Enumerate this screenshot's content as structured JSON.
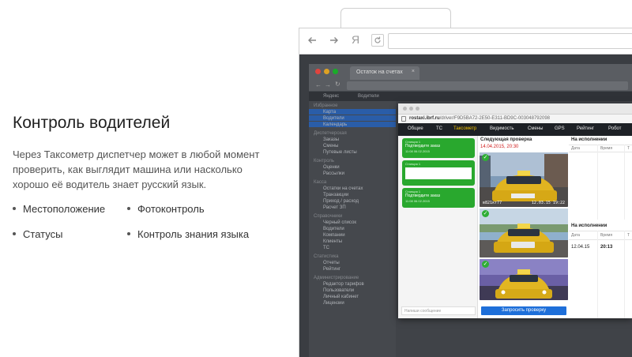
{
  "promo": {
    "title": "Контроль водителей",
    "description": "Через Таксометр диспетчер может в любой момент проверить, как выглядит машина или насколько хорошо её водитель знает русский язык.",
    "features": [
      "Местоположение",
      "Фотоконтроль",
      "Статусы",
      "Контроль знания языка"
    ]
  },
  "outer_browser": {
    "back_icon": "arrow-left",
    "forward_icon": "arrow-right",
    "yandex_logo": "Я",
    "reload_icon": "reload"
  },
  "inner_browser": {
    "tab_title": "Остаток на счетах",
    "topbar": [
      "Яндекс",
      "Водители"
    ],
    "sidebar": [
      {
        "label": "Избранное",
        "group": true
      },
      {
        "label": "Карта",
        "selected": true
      },
      {
        "label": "Водители",
        "selected": true
      },
      {
        "label": "Календарь",
        "selected": true
      },
      {
        "label": "Диспетчерская",
        "group": true
      },
      {
        "label": "Заказы"
      },
      {
        "label": "Смены"
      },
      {
        "label": "Путевые листы"
      },
      {
        "label": "Контроль",
        "group": true
      },
      {
        "label": "Оценки"
      },
      {
        "label": "Рассылки"
      },
      {
        "label": "Касса",
        "group": true
      },
      {
        "label": "Остатки на счетах"
      },
      {
        "label": "Транзакции"
      },
      {
        "label": "Приход / расход"
      },
      {
        "label": "Расчет ЗП"
      },
      {
        "label": "Справочники",
        "group": true
      },
      {
        "label": "Черный список"
      },
      {
        "label": "Водители"
      },
      {
        "label": "Компании"
      },
      {
        "label": "Клиенты"
      },
      {
        "label": "ТС"
      },
      {
        "label": "Статистика",
        "group": true
      },
      {
        "label": "Отчеты"
      },
      {
        "label": "Рейтинг"
      },
      {
        "label": "Администрирование",
        "group": true
      },
      {
        "label": "Редактор тарифов"
      },
      {
        "label": "Пользователи"
      },
      {
        "label": "Личный кабинет"
      },
      {
        "label": "Лицензии"
      }
    ]
  },
  "popup": {
    "url_host": "rostaxi.ibrf.ru",
    "url_path": "/driver/F9D5BA72-2E50-E311-BD9C-003048792098",
    "tabs": [
      "Общие",
      "ТС",
      "Таксометр",
      "Видимость",
      "Смены",
      "GPS",
      "Рейтинг",
      "Робот"
    ],
    "active_tab": "Таксометр",
    "messages": [
      {
        "who": "Станция 1",
        "text": "Подтвердите заказ",
        "when": "11:08 06.02.2015"
      },
      {
        "who": "Станция 1",
        "text": "",
        "when": ""
      },
      {
        "who": "Станция 1",
        "text": "Подтвердите заказ",
        "when": "11:08 06.02.2015"
      }
    ],
    "message_placeholder": "Напиши сообщение",
    "next_check_label": "Следующая проверка",
    "next_check_date": "14.04.2015, 20:30",
    "photo1_stamp_plate": "в821кт77",
    "photo1_stamp_time": "12.03.15  19:22",
    "request_button": "Запросить проверку",
    "exec1_title": "На исполнении",
    "exec_cols": [
      "Дата",
      "Время",
      "Т"
    ],
    "exec2_title": "На исполнении",
    "exec2_date": "12.04.15",
    "exec2_time": "20:13"
  },
  "colors": {
    "accent_green": "#29a82e",
    "accent_blue": "#1e6fd9",
    "active_tab": "#f0c000",
    "sidebar_selected": "#2a5da8"
  }
}
